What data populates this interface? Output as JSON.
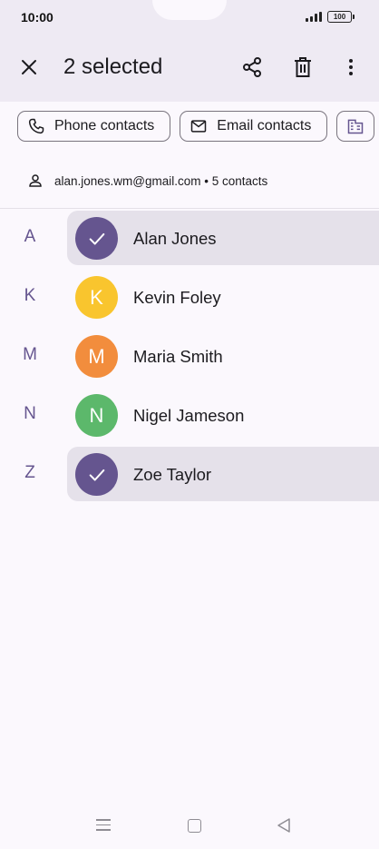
{
  "status_bar": {
    "time": "10:00",
    "battery": "100"
  },
  "header": {
    "title": "2 selected"
  },
  "chips": [
    {
      "label": "Phone contacts",
      "icon": "phone-icon"
    },
    {
      "label": "Email contacts",
      "icon": "mail-icon"
    },
    {
      "label": "",
      "icon": "business-icon"
    }
  ],
  "account": {
    "text": "alan.jones.wm@gmail.com • 5 contacts"
  },
  "contacts": [
    {
      "letter": "A",
      "name": "Alan Jones",
      "initial": "",
      "selected": true,
      "color": "#65558f"
    },
    {
      "letter": "K",
      "name": "Kevin Foley",
      "initial": "K",
      "selected": false,
      "color": "#f9c52e"
    },
    {
      "letter": "M",
      "name": "Maria Smith",
      "initial": "M",
      "selected": false,
      "color": "#f28d3d"
    },
    {
      "letter": "N",
      "name": "Nigel Jameson",
      "initial": "N",
      "selected": false,
      "color": "#5cb86b"
    },
    {
      "letter": "Z",
      "name": "Zoe Taylor",
      "initial": "",
      "selected": true,
      "color": "#65558f"
    }
  ],
  "colors": {
    "accent": "#65558f",
    "header_bg": "#eeeaf3",
    "selected_row": "#e5e1ea"
  }
}
